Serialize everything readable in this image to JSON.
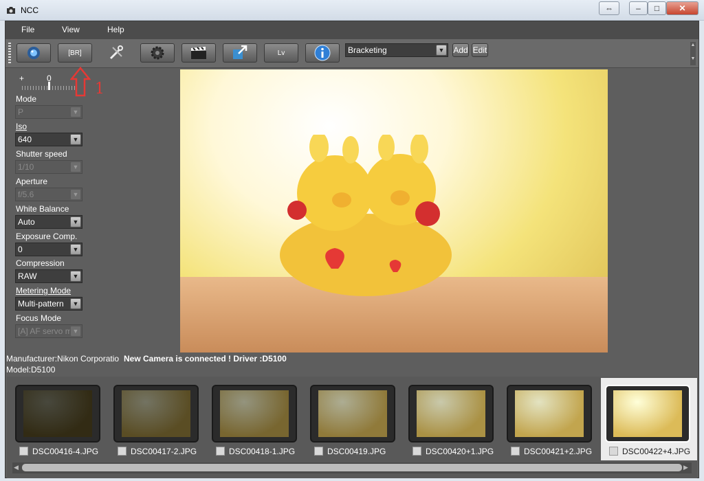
{
  "window": {
    "title": "NCC",
    "restore_icon": "⇔",
    "minimize_icon": "–",
    "maximize_icon": "□",
    "close_icon": "✕"
  },
  "menu": [
    "File",
    "View",
    "Help"
  ],
  "toolbar": {
    "br_label": "[BR]",
    "lv_label": "Lv",
    "preset_select": "Bracketing",
    "add_label": "Add",
    "edit_label": "Edit"
  },
  "annotation": {
    "number": "1"
  },
  "exposure_scale": {
    "plus": "+",
    "zero": "0"
  },
  "settings": [
    {
      "label": "Mode",
      "value": "P",
      "disabled": true
    },
    {
      "label": "Iso",
      "value": "640",
      "disabled": false
    },
    {
      "label": "Shutter speed",
      "value": "1/10",
      "disabled": true
    },
    {
      "label": "Aperture",
      "value": "f/5.6",
      "disabled": true
    },
    {
      "label": "White Balance",
      "value": "Auto",
      "disabled": false
    },
    {
      "label": "Exposure Comp.",
      "value": "0",
      "disabled": false
    },
    {
      "label": "Compression",
      "value": "RAW",
      "disabled": false
    },
    {
      "label": "Metering Mode",
      "value": "Multi-pattern",
      "disabled": false
    },
    {
      "label": "Focus Mode",
      "value": "[A] AF servo m",
      "disabled": true
    }
  ],
  "status": {
    "manufacturer": "Manufacturer:Nikon Corporatio",
    "connection": "New Camera is connected ! Driver :D5100",
    "model": "Model:D5100"
  },
  "thumbnails": [
    {
      "name": "DSC00416-4.JPG",
      "brightness": 0.15
    },
    {
      "name": "DSC00417-2.JPG",
      "brightness": 0.35
    },
    {
      "name": "DSC00418-1.JPG",
      "brightness": 0.5
    },
    {
      "name": "DSC00419.JPG",
      "brightness": 0.62
    },
    {
      "name": "DSC00420+1.JPG",
      "brightness": 0.75
    },
    {
      "name": "DSC00421+2.JPG",
      "brightness": 0.87
    },
    {
      "name": "DSC00422+4.JPG",
      "brightness": 1.0
    }
  ]
}
